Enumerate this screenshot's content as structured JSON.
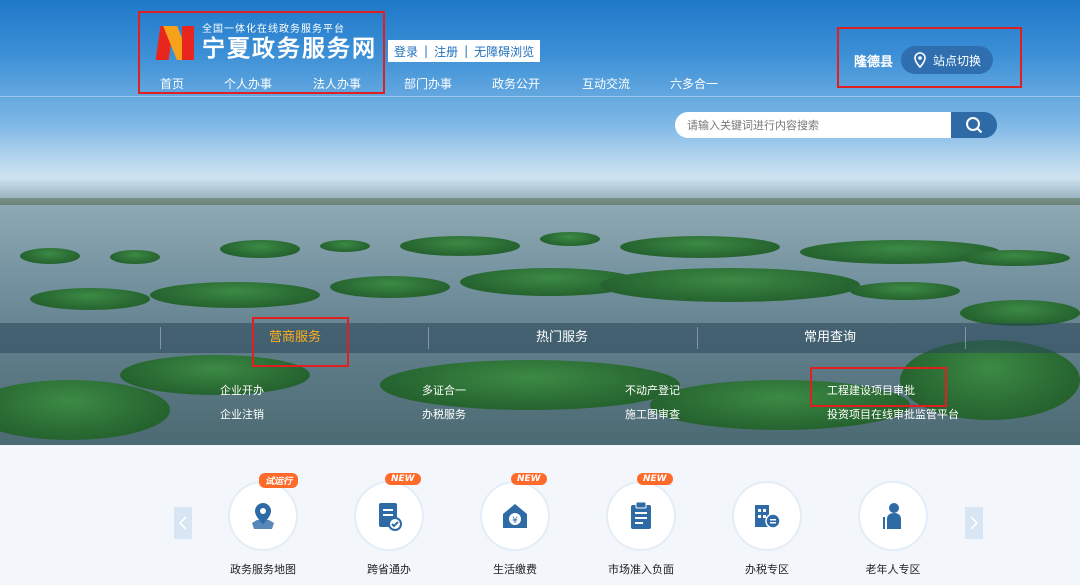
{
  "header": {
    "logo_subtitle": "全国一体化在线政务服务平台",
    "logo_title": "宁夏政务服务网",
    "auth": {
      "login": "登录",
      "register": "注册",
      "accessible": "无障碍浏览"
    },
    "nav": [
      "首页",
      "个人办事",
      "法人办事",
      "部门办事",
      "政务公开",
      "互动交流",
      "六多合一"
    ],
    "site": {
      "county": "隆德县",
      "switch_label": "站点切换",
      "icon": "location-pin-icon"
    },
    "search": {
      "placeholder": "请输入关键词进行内容搜索",
      "icon": "search-icon"
    }
  },
  "tabs": {
    "items": [
      "营商服务",
      "热门服务",
      "常用查询"
    ],
    "active": "营商服务",
    "active_color": "#ffb01a"
  },
  "quick_links": [
    [
      "企业开办",
      "多证合一",
      "不动产登记",
      "工程建设项目审批"
    ],
    [
      "企业注销",
      "办税服务",
      "施工图审查",
      "投资项目在线审批监管平台"
    ]
  ],
  "services": [
    {
      "label": "政务服务地图",
      "badge": "试运行",
      "icon": "map-pin-icon"
    },
    {
      "label": "跨省通办",
      "badge": "NEW",
      "icon": "document-check-icon"
    },
    {
      "label": "生活缴费",
      "badge": "NEW",
      "icon": "payment-house-icon"
    },
    {
      "label": "市场准入负面",
      "badge": "NEW",
      "icon": "clipboard-list-icon"
    },
    {
      "label": "办税专区",
      "badge": "",
      "icon": "tax-building-icon"
    },
    {
      "label": "老年人专区",
      "badge": "",
      "icon": "elderly-person-icon"
    }
  ],
  "colors": {
    "brand_blue": "#1f6fbf",
    "highlight_red": "#e02020",
    "badge_orange": "#ff6a2a",
    "icon_blue": "#2d6aa6"
  }
}
